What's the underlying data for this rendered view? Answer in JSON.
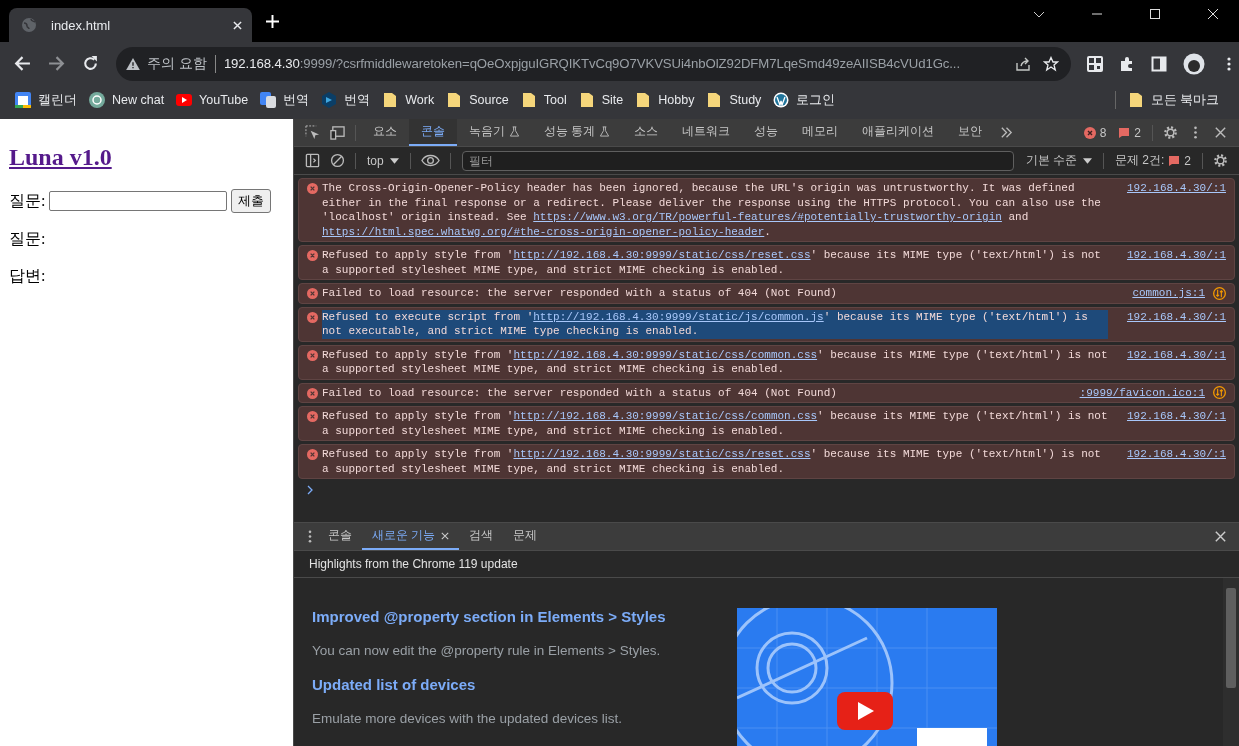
{
  "browser": {
    "tab": {
      "title": "index.html"
    },
    "address": {
      "warning": "주의 요함",
      "host": "192.168.4.30",
      "rest": ":9999/?csrfmiddlewaretoken=qOeOxpjguIGRQIKTvCq9O7VKVSUi4nbOlZ92DFM7LqeSmd49zeAIISB4cVUd1Gc..."
    },
    "bookmarks": [
      {
        "kind": "calendar",
        "label": "캘린더"
      },
      {
        "kind": "chat",
        "label": "New chat"
      },
      {
        "kind": "video",
        "label": "YouTube"
      },
      {
        "kind": "translate",
        "label": "번역"
      },
      {
        "kind": "hexagon",
        "label": "번역"
      },
      {
        "kind": "folder",
        "label": "Work"
      },
      {
        "kind": "folder",
        "label": "Source"
      },
      {
        "kind": "folder",
        "label": "Tool"
      },
      {
        "kind": "folder",
        "label": "Site"
      },
      {
        "kind": "folder",
        "label": "Hobby"
      },
      {
        "kind": "folder",
        "label": "Study"
      },
      {
        "kind": "wordpress",
        "label": "로그인"
      }
    ],
    "all_bookmarks": "모든 북마크"
  },
  "page": {
    "title": "Luna v1.0",
    "question_label": "질문:",
    "submit": "제출",
    "question": "질문:",
    "answer": "답변:"
  },
  "devtools": {
    "tabs": [
      {
        "label": "요소",
        "selected": false,
        "experimental": false
      },
      {
        "label": "콘솔",
        "selected": true,
        "experimental": false
      },
      {
        "label": "녹음기",
        "selected": false,
        "experimental": true
      },
      {
        "label": "성능 통계",
        "selected": false,
        "experimental": true
      },
      {
        "label": "소스",
        "selected": false,
        "experimental": false
      },
      {
        "label": "네트워크",
        "selected": false,
        "experimental": false
      },
      {
        "label": "성능",
        "selected": false,
        "experimental": false
      },
      {
        "label": "메모리",
        "selected": false,
        "experimental": false
      },
      {
        "label": "애플리케이션",
        "selected": false,
        "experimental": false
      },
      {
        "label": "보안",
        "selected": false,
        "experimental": false
      }
    ],
    "error_count": "8",
    "issue_count": "2",
    "console_toolbar": {
      "context": "top",
      "filter_placeholder": "필터",
      "levels": "기본 수준",
      "issues_label": "문제 2건:",
      "issues_count": "2"
    },
    "messages": [
      {
        "segments": [
          {
            "kind": "text",
            "text": "The Cross-Origin-Opener-Policy header has been ignored, because the URL's origin was untrustworthy. It was defined either in the final response or a redirect. Please deliver the response using the HTTPS protocol. You can also use the 'localhost' origin instead. See "
          },
          {
            "kind": "link",
            "text": "https://www.w3.org/TR/powerful-features/#potentially-trustworthy-origin"
          },
          {
            "kind": "text",
            "text": " and "
          },
          {
            "kind": "link",
            "text": "https://html.spec.whatwg.org/#the-cross-origin-opener-policy-header"
          },
          {
            "kind": "text",
            "text": "."
          }
        ],
        "source": "192.168.4.30/:1",
        "network": false,
        "selected": false
      },
      {
        "segments": [
          {
            "kind": "text",
            "text": "Refused to apply style from '"
          },
          {
            "kind": "link",
            "text": "http://192.168.4.30:9999/static/css/reset.css"
          },
          {
            "kind": "text",
            "text": "' because its MIME type ('text/html') is not a supported stylesheet MIME type, and strict MIME checking is enabled."
          }
        ],
        "source": "192.168.4.30/:1",
        "network": false,
        "selected": false
      },
      {
        "segments": [
          {
            "kind": "text",
            "text": "Failed to load resource: the server responded with a status of 404 (Not Found)"
          }
        ],
        "source": "common.js:1",
        "network": true,
        "selected": false
      },
      {
        "segments": [
          {
            "kind": "text",
            "text": "Refused to execute script from '"
          },
          {
            "kind": "link",
            "text": "http://192.168.4.30:9999/static/js/common.js"
          },
          {
            "kind": "text",
            "text": "' because its MIME type ('text/html') is not executable, and strict MIME type checking is enabled."
          }
        ],
        "source": "192.168.4.30/:1",
        "network": false,
        "selected": true
      },
      {
        "segments": [
          {
            "kind": "text",
            "text": "Refused to apply style from '"
          },
          {
            "kind": "link",
            "text": "http://192.168.4.30:9999/static/css/common.css"
          },
          {
            "kind": "text",
            "text": "' because its MIME type ('text/html') is not a supported stylesheet MIME type, and strict MIME checking is enabled."
          }
        ],
        "source": "192.168.4.30/:1",
        "network": false,
        "selected": false
      },
      {
        "segments": [
          {
            "kind": "text",
            "text": "Failed to load resource: the server responded with a status of 404 (Not Found)"
          }
        ],
        "source": ":9999/favicon.ico:1",
        "network": true,
        "selected": false
      },
      {
        "segments": [
          {
            "kind": "text",
            "text": "Refused to apply style from '"
          },
          {
            "kind": "link",
            "text": "http://192.168.4.30:9999/static/css/common.css"
          },
          {
            "kind": "text",
            "text": "' because its MIME type ('text/html') is not a supported stylesheet MIME type, and strict MIME checking is enabled."
          }
        ],
        "source": "192.168.4.30/:1",
        "network": false,
        "selected": false
      },
      {
        "segments": [
          {
            "kind": "text",
            "text": "Refused to apply style from '"
          },
          {
            "kind": "link",
            "text": "http://192.168.4.30:9999/static/css/reset.css"
          },
          {
            "kind": "text",
            "text": "' because its MIME type ('text/html') is not a supported stylesheet MIME type, and strict MIME checking is enabled."
          }
        ],
        "source": "192.168.4.30/:1",
        "network": false,
        "selected": false
      }
    ],
    "drawer": {
      "tabs": [
        {
          "label": "콘솔",
          "selected": false,
          "closable": false
        },
        {
          "label": "새로운 기능",
          "selected": true,
          "closable": true
        },
        {
          "label": "검색",
          "selected": false,
          "closable": false
        },
        {
          "label": "문제",
          "selected": false,
          "closable": false
        }
      ],
      "header": "Highlights from the Chrome 119 update",
      "features": [
        {
          "title": "Improved @property section in Elements > Styles",
          "description": "You can now edit the @property rule in Elements > Styles."
        },
        {
          "title": "Updated list of devices",
          "description": "Emulate more devices with the updated devices list."
        }
      ]
    }
  }
}
